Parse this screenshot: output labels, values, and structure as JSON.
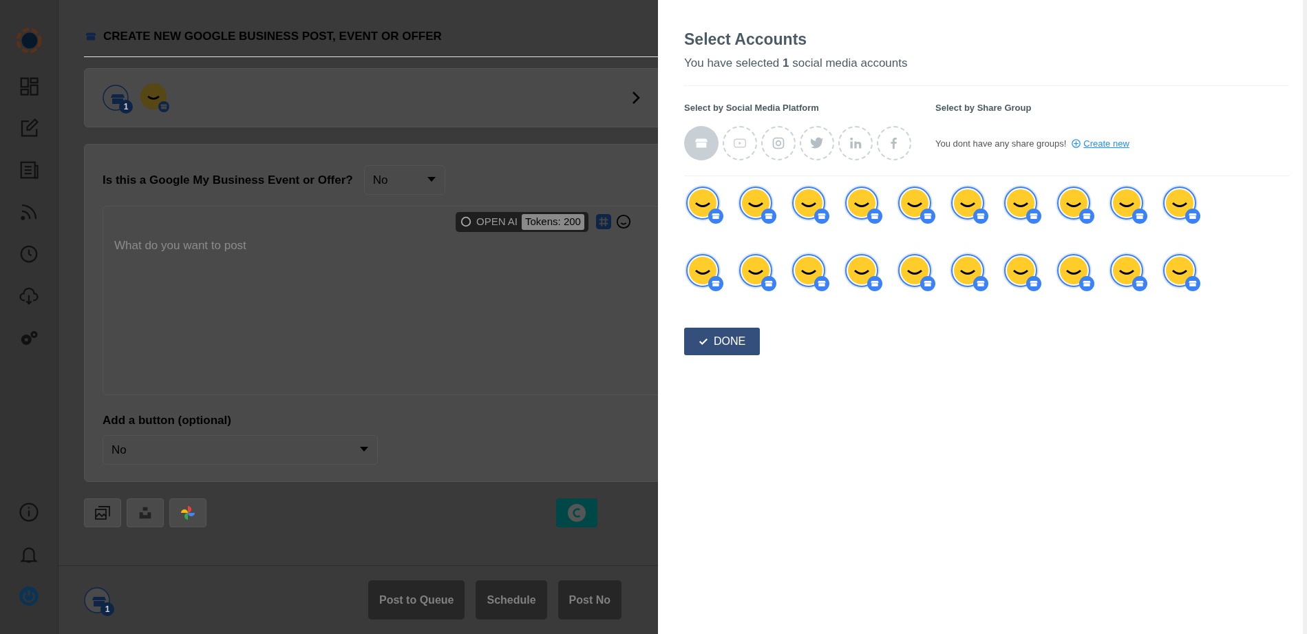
{
  "sidebar": {
    "nav_items": [
      {
        "kind": "dashboard"
      },
      {
        "kind": "compose"
      },
      {
        "kind": "article"
      },
      {
        "kind": "feed"
      },
      {
        "kind": "recycle"
      },
      {
        "kind": "download"
      },
      {
        "kind": "settings"
      }
    ],
    "bottom_items": [
      {
        "kind": "info"
      },
      {
        "kind": "bell"
      },
      {
        "kind": "power"
      }
    ]
  },
  "page_title": "CREATE NEW GOOGLE BUSINESS POST, EVENT OR OFFER",
  "accounts_bar": {
    "count_badge": "1"
  },
  "event_question": {
    "label": "Is this a Google My Business Event or Offer?",
    "value": "No"
  },
  "editor": {
    "placeholder": "What do you want to post",
    "openai_label": "OPEN AI",
    "tokens": "Tokens: 200"
  },
  "button_option": {
    "label": "Add a button (optional)",
    "value": "No"
  },
  "media_tools": [
    {
      "kind": "gallery"
    },
    {
      "kind": "unsplash"
    },
    {
      "kind": "photos"
    }
  ],
  "footer": {
    "count_badge": "1",
    "buttons": [
      "Post to Queue",
      "Schedule",
      "Post No"
    ]
  },
  "panel": {
    "title": "Select Accounts",
    "subtitle": "You have selected **1** social media accounts",
    "platform_heading": "Select by Social Media Platform",
    "platforms": [
      {
        "kind": "business",
        "selected": true
      },
      {
        "kind": "youtube",
        "selected": false
      },
      {
        "kind": "instagram",
        "selected": false
      },
      {
        "kind": "twitter",
        "selected": false
      },
      {
        "kind": "linkedin",
        "selected": false
      },
      {
        "kind": "facebook",
        "selected": false
      }
    ],
    "share_group_heading": "Select by Share Group",
    "share_group_note": "You dont have any share groups!",
    "create_link": "Create new",
    "accounts": [
      {
        "kind": "business"
      },
      {
        "kind": "business"
      },
      {
        "kind": "business"
      },
      {
        "kind": "business"
      },
      {
        "kind": "business"
      },
      {
        "kind": "business"
      },
      {
        "kind": "business"
      },
      {
        "kind": "business"
      },
      {
        "kind": "business"
      },
      {
        "kind": "business"
      },
      {
        "kind": "business"
      },
      {
        "kind": "business"
      },
      {
        "kind": "business"
      },
      {
        "kind": "business"
      },
      {
        "kind": "business"
      },
      {
        "kind": "business"
      },
      {
        "kind": "business"
      },
      {
        "kind": "business"
      },
      {
        "kind": "business"
      },
      {
        "kind": "business"
      }
    ],
    "done_button": "DONE"
  }
}
